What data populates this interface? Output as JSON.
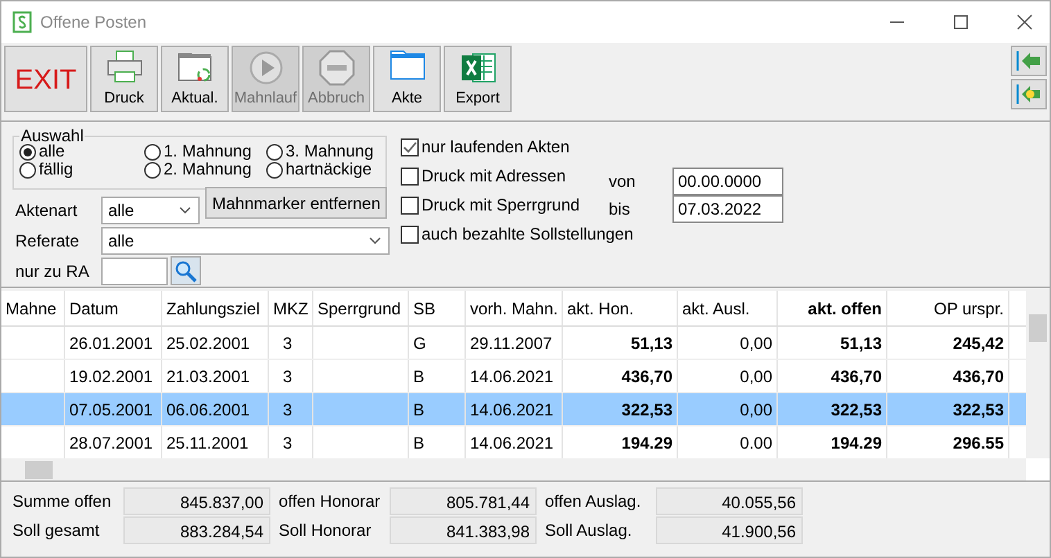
{
  "window": {
    "title": "Offene Posten"
  },
  "toolbar": [
    {
      "label": "EXIT",
      "kind": "exit",
      "disabled": false
    },
    {
      "label": "Druck",
      "kind": "printer",
      "disabled": false
    },
    {
      "label": "Aktual.",
      "kind": "refresh",
      "disabled": false
    },
    {
      "label": "Mahnlauf",
      "kind": "play",
      "disabled": true
    },
    {
      "label": "Abbruch",
      "kind": "stop",
      "disabled": true
    },
    {
      "label": "Akte",
      "kind": "folder",
      "disabled": false
    },
    {
      "label": "Export",
      "kind": "excel",
      "disabled": false
    }
  ],
  "auswahl": {
    "legend": "Auswahl",
    "options": [
      {
        "label": "alle",
        "selected": true
      },
      {
        "label": "1. Mahnung",
        "selected": false
      },
      {
        "label": "3. Mahnung",
        "selected": false
      },
      {
        "label": "fällig",
        "selected": false
      },
      {
        "label": "2. Mahnung",
        "selected": false
      },
      {
        "label": "hartnäckige",
        "selected": false
      }
    ]
  },
  "filters": {
    "aktenart": {
      "label": "Aktenart",
      "value": "alle"
    },
    "remove_button": "Mahnmarker entfernen",
    "referate": {
      "label": "Referate",
      "value": "alle"
    },
    "ra": {
      "label": "nur zu RA"
    }
  },
  "checkboxes": [
    {
      "label": "nur laufenden Akten",
      "checked": true
    },
    {
      "label": "Druck mit Adressen",
      "checked": false
    },
    {
      "label": "Druck mit Sperrgrund",
      "checked": false
    },
    {
      "label": "auch bezahlte Sollstellungen",
      "checked": false
    }
  ],
  "date_range": [
    {
      "label": "von",
      "value": "00.00.0000"
    },
    {
      "label": "bis",
      "value": "07.03.2022"
    }
  ],
  "table": {
    "columns": [
      "Mahne",
      "Datum",
      "Zahlungsziel",
      "MKZ",
      "Sperrgrund",
      "SB",
      "vorh. Mahn.",
      "akt. Hon.",
      "akt. Ausl.",
      "akt. offen",
      "OP urspr."
    ],
    "rows": [
      {
        "selected": false,
        "cells": [
          "",
          "26.01.2001",
          "25.02.2001",
          "3",
          "",
          "G",
          "29.11.2007",
          "51,13",
          "0,00",
          "51,13",
          "245,42"
        ]
      },
      {
        "selected": false,
        "cells": [
          "",
          "19.02.2001",
          "21.03.2001",
          "3",
          "",
          "B",
          "14.06.2021",
          "436,70",
          "0,00",
          "436,70",
          "436,70"
        ]
      },
      {
        "selected": true,
        "cells": [
          "",
          "07.05.2001",
          "06.06.2001",
          "3",
          "",
          "B",
          "14.06.2021",
          "322,53",
          "0,00",
          "322,53",
          "322,53"
        ]
      },
      {
        "selected": false,
        "cells": [
          "",
          "28.07.2001",
          "25.11.2001",
          "3",
          "",
          "B",
          "14.06.2021",
          "194.29",
          "0.00",
          "194.29",
          "296.55"
        ]
      }
    ]
  },
  "totals": [
    {
      "label": "Summe offen",
      "value": "845.837,00"
    },
    {
      "label": "offen Honorar",
      "value": "805.781,44"
    },
    {
      "label": "offen Auslag.",
      "value": "40.055,56"
    },
    {
      "label": "Soll gesamt",
      "value": "883.284,54"
    },
    {
      "label": "Soll Honorar",
      "value": "841.383,98"
    },
    {
      "label": "Soll Auslag.",
      "value": "41.900,56"
    }
  ]
}
